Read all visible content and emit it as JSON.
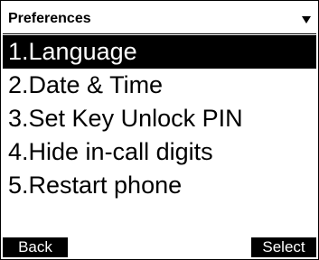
{
  "header": {
    "title": "Preferences",
    "arrow_icon": "triangle-down-icon"
  },
  "menu": {
    "selected_index": 0,
    "items": [
      {
        "label": "1.Language"
      },
      {
        "label": "2.Date & Time"
      },
      {
        "label": "3.Set Key Unlock PIN"
      },
      {
        "label": "4.Hide in-call digits"
      },
      {
        "label": "5.Restart phone"
      }
    ]
  },
  "softkeys": {
    "left_label": "Back",
    "right_label": "Select"
  },
  "colors": {
    "background": "#ffffff",
    "foreground": "#000000",
    "highlight": "#000000",
    "highlight_text": "#ffffff"
  }
}
